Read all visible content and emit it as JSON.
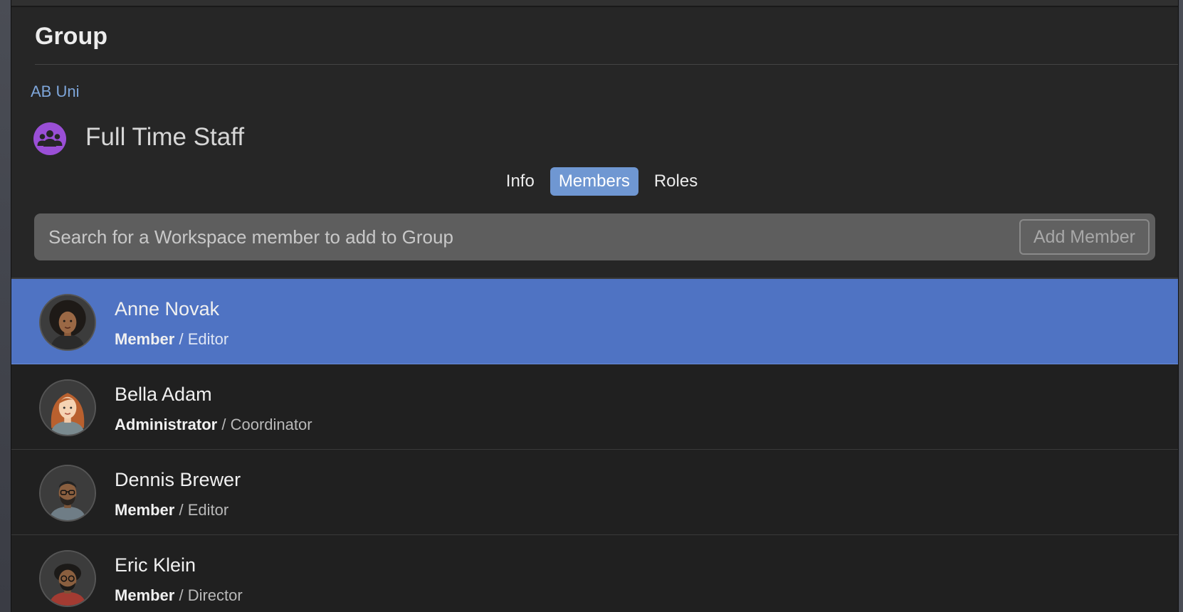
{
  "header": {
    "title": "Group"
  },
  "breadcrumb": {
    "label": "AB Uni"
  },
  "group": {
    "name": "Full Time Staff",
    "icon": "group-people-icon",
    "icon_color": "#9a4fd6"
  },
  "tabs": [
    {
      "label": "Info",
      "active": false
    },
    {
      "label": "Members",
      "active": true
    },
    {
      "label": "Roles",
      "active": false
    }
  ],
  "search": {
    "placeholder": "Search for a Workspace member to add to Group",
    "value": "",
    "button_label": "Add Member"
  },
  "members": [
    {
      "name": "Anne Novak",
      "role": "Member",
      "separator": " / ",
      "title": "Editor",
      "selected": true,
      "avatar": "woman-afro-avatar"
    },
    {
      "name": "Bella Adam",
      "role": "Administrator",
      "separator": " / ",
      "title": "Coordinator",
      "selected": false,
      "avatar": "woman-red-hair-avatar"
    },
    {
      "name": "Dennis Brewer",
      "role": "Member",
      "separator": " / ",
      "title": "Editor",
      "selected": false,
      "avatar": "man-glasses-beard-avatar"
    },
    {
      "name": "Eric Klein",
      "role": "Member",
      "separator": " / ",
      "title": "Director",
      "selected": false,
      "avatar": "man-curly-glasses-avatar"
    }
  ],
  "colors": {
    "accent": "#6f97d2",
    "selection": "#4f73c3",
    "link": "#7ea6da",
    "panel_bg": "#262626"
  }
}
